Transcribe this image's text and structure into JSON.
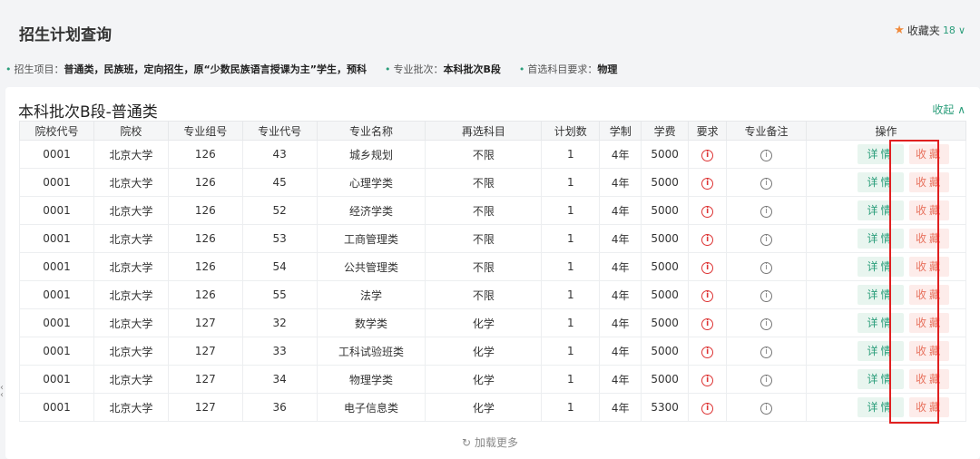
{
  "header": {
    "title": "招生计划查询",
    "favorites_label": "收藏夹",
    "favorites_count": "18"
  },
  "filters": [
    {
      "label": "招生项目：",
      "value": "普通类，民族班，定向招生，原“少数民族语言授课为主”学生，预科"
    },
    {
      "label": "专业批次：",
      "value": "本科批次B段"
    },
    {
      "label": "首选科目要求：",
      "value": "物理"
    }
  ],
  "section": {
    "title": "本科批次B段-普通类",
    "collapse_label": "收起 ∧"
  },
  "table": {
    "headers": [
      "院校代号",
      "院校",
      "专业组号",
      "专业代号",
      "专业名称",
      "再选科目",
      "计划数",
      "学制",
      "学费",
      "要求",
      "专业备注",
      "操作"
    ],
    "detail_label": "详情",
    "fav_label": "收藏",
    "rows": [
      {
        "code": "0001",
        "school": "北京大学",
        "group": "126",
        "major_code": "43",
        "major": "城乡规划",
        "subject": "不限",
        "plan": "1",
        "years": "4年",
        "fee": "5000"
      },
      {
        "code": "0001",
        "school": "北京大学",
        "group": "126",
        "major_code": "45",
        "major": "心理学类",
        "subject": "不限",
        "plan": "1",
        "years": "4年",
        "fee": "5000"
      },
      {
        "code": "0001",
        "school": "北京大学",
        "group": "126",
        "major_code": "52",
        "major": "经济学类",
        "subject": "不限",
        "plan": "1",
        "years": "4年",
        "fee": "5000"
      },
      {
        "code": "0001",
        "school": "北京大学",
        "group": "126",
        "major_code": "53",
        "major": "工商管理类",
        "subject": "不限",
        "plan": "1",
        "years": "4年",
        "fee": "5000"
      },
      {
        "code": "0001",
        "school": "北京大学",
        "group": "126",
        "major_code": "54",
        "major": "公共管理类",
        "subject": "不限",
        "plan": "1",
        "years": "4年",
        "fee": "5000"
      },
      {
        "code": "0001",
        "school": "北京大学",
        "group": "126",
        "major_code": "55",
        "major": "法学",
        "subject": "不限",
        "plan": "1",
        "years": "4年",
        "fee": "5000"
      },
      {
        "code": "0001",
        "school": "北京大学",
        "group": "127",
        "major_code": "32",
        "major": "数学类",
        "subject": "化学",
        "plan": "1",
        "years": "4年",
        "fee": "5000"
      },
      {
        "code": "0001",
        "school": "北京大学",
        "group": "127",
        "major_code": "33",
        "major": "工科试验班类",
        "subject": "化学",
        "plan": "1",
        "years": "4年",
        "fee": "5000"
      },
      {
        "code": "0001",
        "school": "北京大学",
        "group": "127",
        "major_code": "34",
        "major": "物理学类",
        "subject": "化学",
        "plan": "1",
        "years": "4年",
        "fee": "5000"
      },
      {
        "code": "0001",
        "school": "北京大学",
        "group": "127",
        "major_code": "36",
        "major": "电子信息类",
        "subject": "化学",
        "plan": "1",
        "years": "4年",
        "fee": "5300"
      }
    ]
  },
  "load_more_label": "加载更多",
  "colors": {
    "accent": "#2a9d7a",
    "favorite": "#e8735f",
    "highlight": "#e02020"
  },
  "icons": {
    "requirement": "info-circle-red-icon",
    "note": "info-circle-icon",
    "reload": "reload-icon",
    "star": "star-icon"
  }
}
